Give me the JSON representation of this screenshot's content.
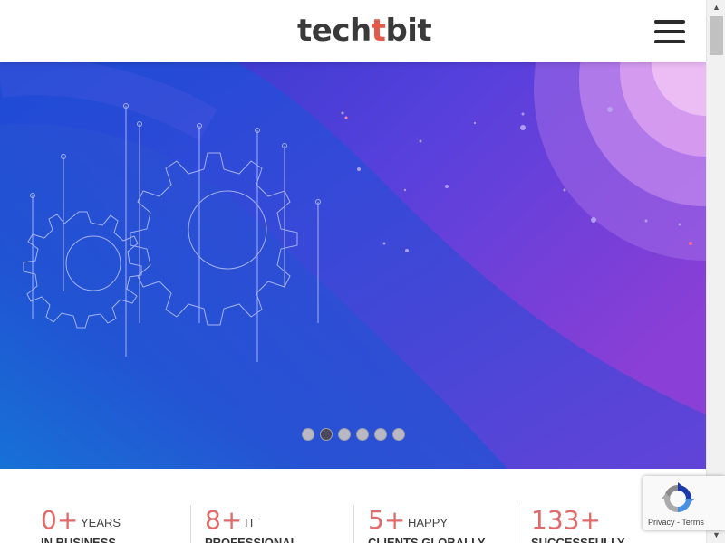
{
  "brand": {
    "logo_prefix": "tech",
    "logo_accent": "t",
    "logo_suffix": "bit",
    "accent_color": "#e2584b",
    "text_color": "#3a3a3a"
  },
  "header": {
    "menu_icon": "hamburger-menu-icon"
  },
  "hero": {
    "background_colors": [
      "#1a3fd0",
      "#5a3ee0",
      "#7a3fd8"
    ],
    "illustration": "gears-circuit-illustration",
    "slider": {
      "slide_count": 6,
      "active_index": 1
    }
  },
  "stats": [
    {
      "number": "0+",
      "label_top": "YEARS",
      "label_bottom": "IN BUSINESS"
    },
    {
      "number": "8+",
      "label_top": "IT",
      "label_bottom": "PROFESSIONAL"
    },
    {
      "number": "5+",
      "label_top": "HAPPY",
      "label_bottom": "CLIENTS GLOBALLY"
    },
    {
      "number": "133+",
      "label_top": "",
      "label_bottom": "SUCCESSFULLY"
    }
  ],
  "recaptcha": {
    "privacy": "Privacy",
    "separator": " - ",
    "terms": "Terms"
  },
  "scrollbar": {
    "up_arrow": "▲",
    "down_arrow": "▼"
  }
}
